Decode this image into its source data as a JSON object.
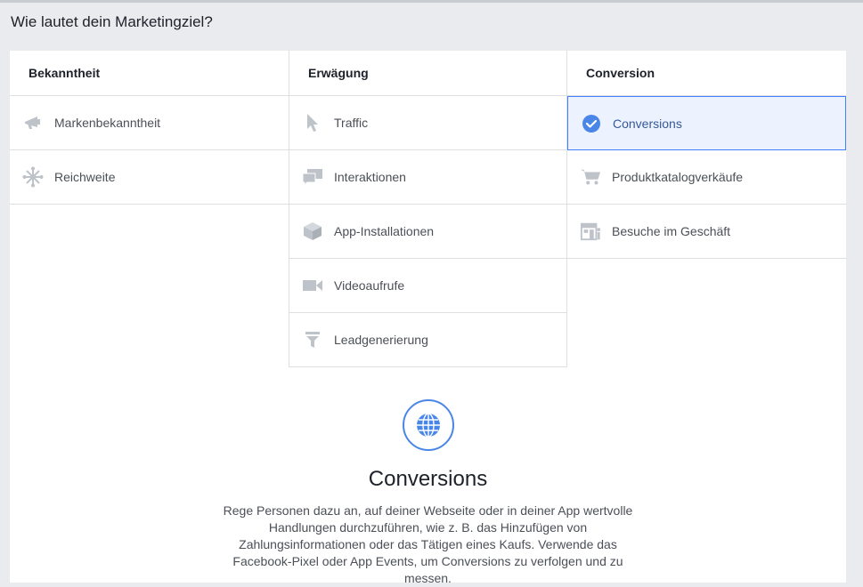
{
  "heading": "Wie lautet dein Marketingziel?",
  "columns": [
    {
      "title": "Bekanntheit",
      "items": [
        {
          "label": "Markenbekanntheit",
          "icon": "megaphone-icon"
        },
        {
          "label": "Reichweite",
          "icon": "reach-icon"
        }
      ]
    },
    {
      "title": "Erwägung",
      "items": [
        {
          "label": "Traffic",
          "icon": "cursor-icon"
        },
        {
          "label": "Interaktionen",
          "icon": "chat-bubbles-icon"
        },
        {
          "label": "App-Installationen",
          "icon": "cube-icon"
        },
        {
          "label": "Videoaufrufe",
          "icon": "video-camera-icon"
        },
        {
          "label": "Leadgenerierung",
          "icon": "funnel-icon"
        }
      ]
    },
    {
      "title": "Conversion",
      "items": [
        {
          "label": "Conversions",
          "icon": "check-circle-icon",
          "selected": true
        },
        {
          "label": "Produktkatalogverkäufe",
          "icon": "shopping-cart-icon"
        },
        {
          "label": "Besuche im Geschäft",
          "icon": "store-icon"
        }
      ]
    }
  ],
  "detail": {
    "icon": "globe-icon",
    "title": "Conversions",
    "text": "Rege Personen dazu an, auf deiner Webseite oder in deiner App wertvolle Handlungen durchzuführen, wie z. B. das Hinzufügen von Zahlungsinformationen oder das Tätigen eines Kaufs. Verwende das Facebook-Pixel oder App Events, um Conversions zu verfolgen und zu messen."
  },
  "colors": {
    "accent": "#4080ff",
    "selected_bg": "#ecf3ff",
    "icon_gray": "#bec3c9",
    "page_bg": "#e9ebee"
  }
}
